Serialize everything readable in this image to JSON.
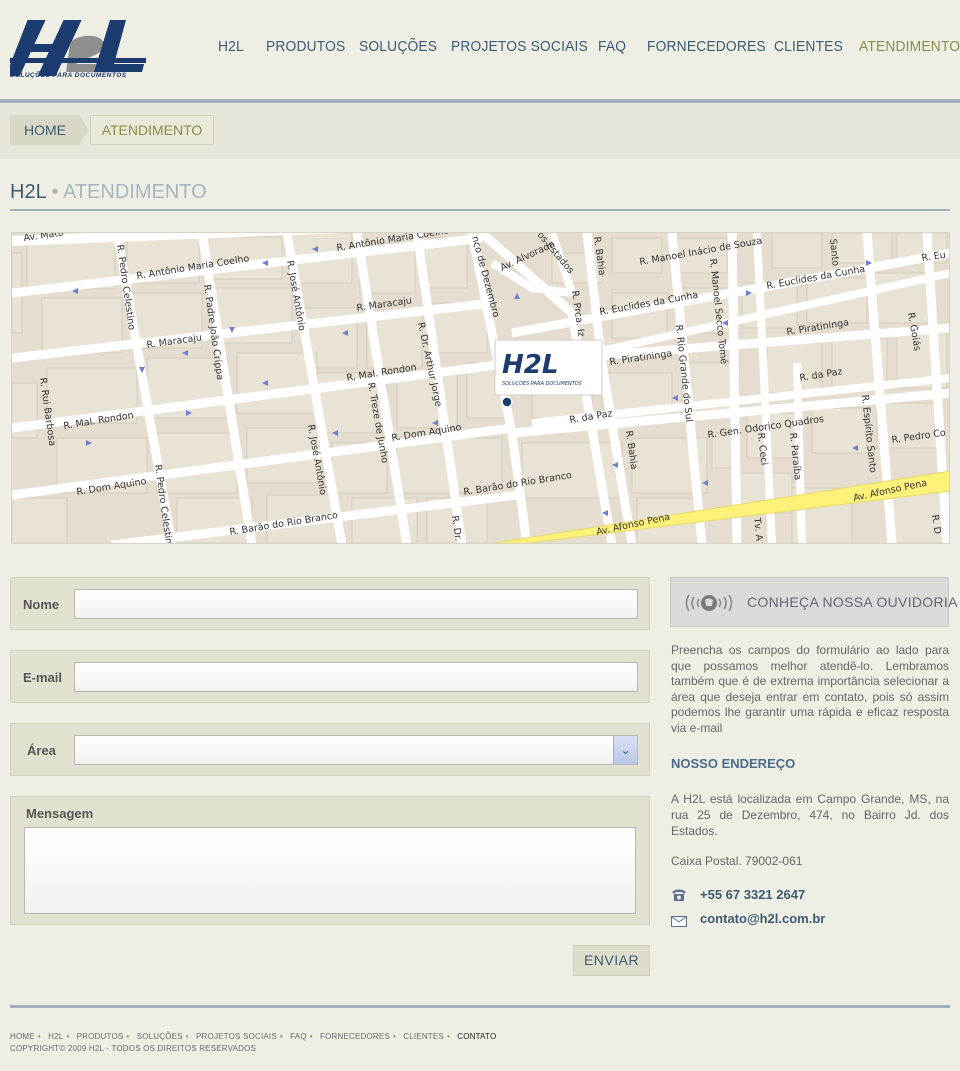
{
  "brand": {
    "logo_text": "H2L",
    "tagline": "SOLUÇÕES PARA DOCUMENTOS",
    "primary_color": "#1c3b6e",
    "accent_color": "#8d8c4a"
  },
  "nav": {
    "items": [
      {
        "label": "H2L"
      },
      {
        "label": "PRODUTOS"
      },
      {
        "label": "SOLUÇÕES"
      },
      {
        "label": "PROJETOS SOCIAIS"
      },
      {
        "label": "FAQ"
      },
      {
        "label": "FORNECEDORES"
      },
      {
        "label": "CLIENTES"
      },
      {
        "label": "ATENDIMENTO"
      }
    ],
    "active": "ATENDIMENTO"
  },
  "breadcrumb": {
    "home": "HOME",
    "current": "ATENDIMENTO"
  },
  "page_title": {
    "main": "H2L",
    "separator": "•",
    "sub": "ATENDIMENTO"
  },
  "map": {
    "streets": [
      "Av. Mato",
      "R. Antônio Maria Coelho",
      "R. Antônio Maria Coelho",
      "R. Pedro Celestino",
      "R. Padre João Crippa",
      "R. José Antônio",
      "R. Maracaju",
      "R. Maracaju",
      "R. Mal. Rondon",
      "R. Mal. Rondon",
      "R. Rui Barbosa",
      "R. Dom Aquino",
      "R. Dom Aquino",
      "R. Pedro Celestino",
      "R. Barão do Rio Branco",
      "R. Barão do Rio Branco",
      "R. José Antônio",
      "R. Treze de Junho",
      "R. Dr. Arthur Jorge",
      "nco de Dezembro",
      "Av. Alvorada",
      "os Estados",
      "R. Bahia",
      "R. Manoel Inácio de Souza",
      "R. Euclides da Cunha",
      "R. Euclides da Cunha",
      "R. Manoel Secco Tomé",
      "R. Rio Grande do Sul",
      "R. Piratininga",
      "R. Piratininga",
      "R. da Paz",
      "R. da Paz",
      "R. Bahia",
      "R. Gen. Odorico Quadros",
      "R. Ceci",
      "R. Paraíba",
      "R. Espírito Santo",
      "R. Goiás",
      "R. Pedro Co",
      "Av. Afonso Pena",
      "Av. Afonso Pena",
      "Santo",
      "R. Eu",
      "R. Prca. Iz",
      "R. Dr.",
      "R. D",
      "Tv. A"
    ],
    "marker_logo": "H2L",
    "marker_tagline": "SOLUÇÕES PARA DOCUMENTOS"
  },
  "form": {
    "nome_label": "Nome",
    "nome_value": "",
    "email_label": "E-mail",
    "email_value": "",
    "area_label": "Área",
    "area_value": "",
    "mensagem_label": "Mensagem",
    "mensagem_value": "",
    "submit_label": "ENVIAR"
  },
  "sidebar": {
    "ombudsman_label": "CONHEÇA NOSSA OUVIDORIA",
    "intro": "Preencha os campos do formulário ao lado para que possamos melhor atendê-lo. Lembramos também que é de extrema importância selecionar a área que deseja entrar em contato, pois só assim podemos lhe garantir uma rápida e eficaz resposta via e-mail",
    "address_heading": "NOSSO ENDEREÇO",
    "address": "A H2L está localizada em Campo Grande, MS, na rua 25 de Dezembro, 474, no Bairro Jd. dos Estados.",
    "pobox": "Caixa Postal. 79002-061",
    "phone": "+55 67 3321 2647",
    "email": "contato@h2l.com.br"
  },
  "footer": {
    "links": [
      "HOME",
      "H2L",
      "PRODUTOS",
      "SOLUÇÕES",
      "PROJETOS SOCIAIS",
      "FAQ",
      "FORNECEDORES",
      "CLIENTES",
      "CONTATO"
    ],
    "separator": "•",
    "copyright": "COPYRIGHT© 2009 H2L - TODOS OS DIREITOS RESERVADOS"
  }
}
